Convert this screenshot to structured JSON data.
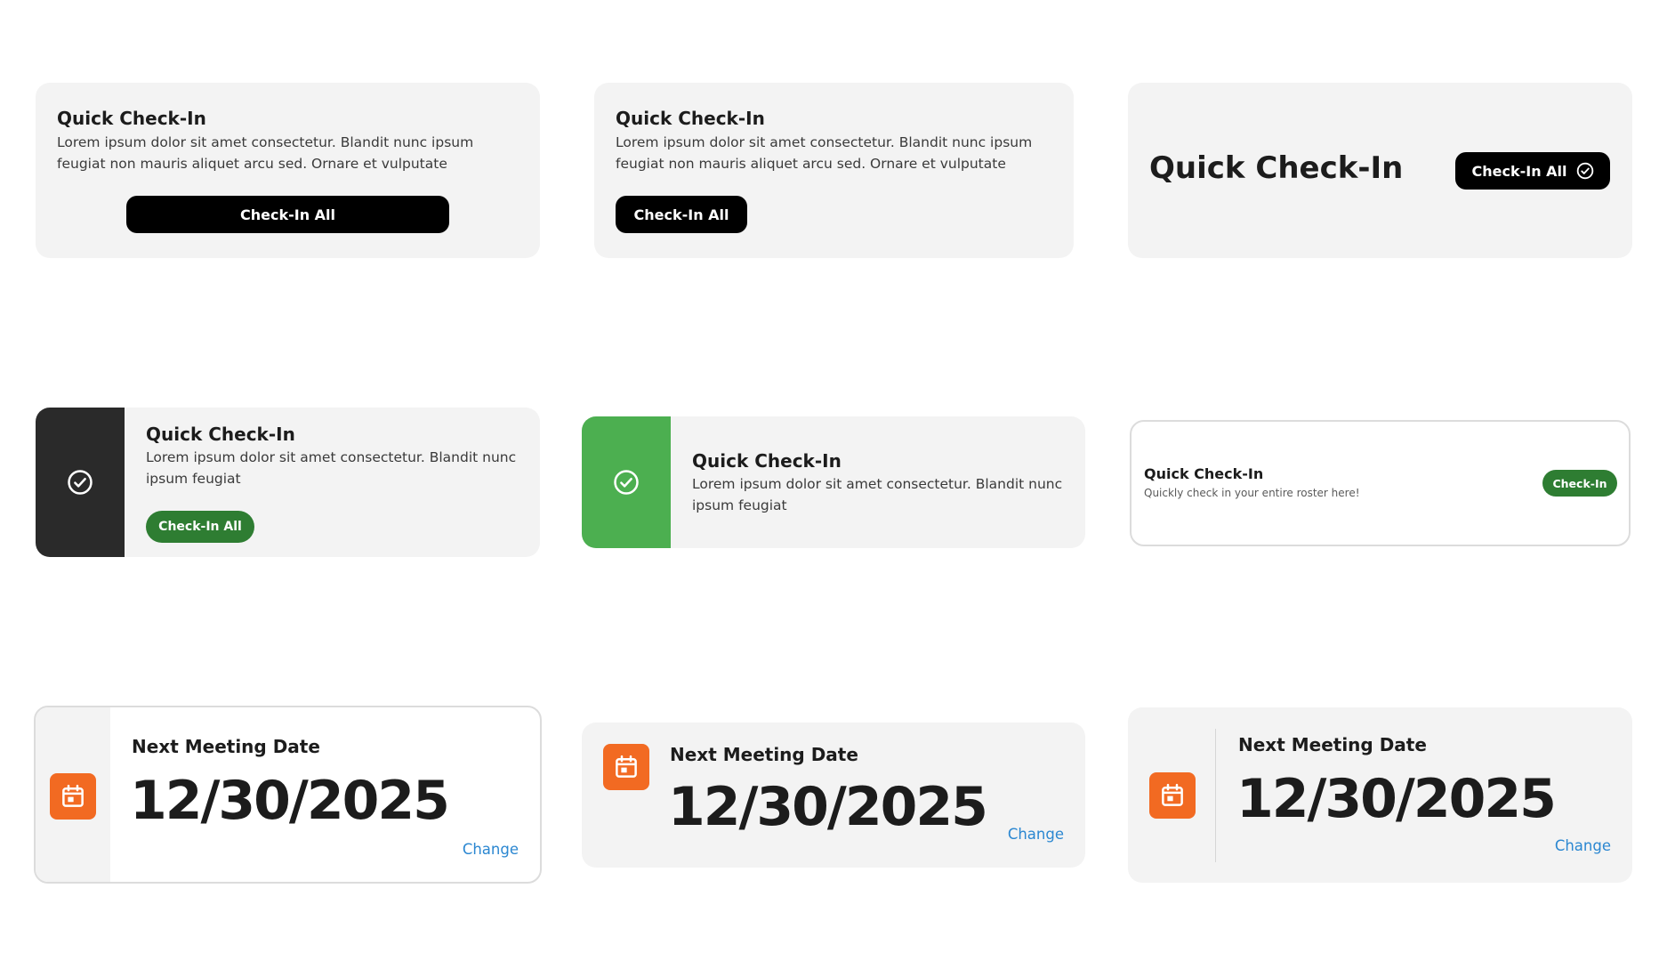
{
  "colors": {
    "card_bg": "#f3f3f3",
    "black": "#000000",
    "dark_panel": "#2a2a2a",
    "green_panel": "#4caf50",
    "green_button": "#2e7d32",
    "calendar_orange": "#f26a22",
    "link_blue": "#2b87d1"
  },
  "checkin_cards": [
    {
      "title": "Quick Check-In",
      "body": "Lorem ipsum dolor sit amet consectetur. Blandit nunc ipsum feugiat non mauris aliquet arcu sed. Ornare et vulputate",
      "button": "Check-In All"
    },
    {
      "title": "Quick Check-In",
      "body": "Lorem ipsum dolor sit amet consectetur. Blandit nunc ipsum feugiat non mauris aliquet arcu sed. Ornare et vulputate",
      "button": "Check-In All"
    },
    {
      "title": "Quick Check-In",
      "button": "Check-In All",
      "button_icon": "check-circle-icon"
    },
    {
      "title": "Quick Check-In",
      "body": "Lorem ipsum dolor sit amet consectetur. Blandit nunc ipsum feugiat",
      "button": "Check-In All",
      "side_icon": "check-circle-icon"
    },
    {
      "title": "Quick Check-In",
      "body": "Lorem ipsum dolor sit amet consectetur. Blandit nunc ipsum feugiat",
      "side_icon": "check-circle-icon"
    },
    {
      "title": "Quick Check-In",
      "subtitle": "Quickly check in your entire roster here!",
      "button": "Check-In"
    }
  ],
  "meeting_cards": [
    {
      "label": "Next Meeting Date",
      "date": "12/30/2025",
      "link": "Change",
      "icon": "calendar-icon"
    },
    {
      "label": "Next Meeting Date",
      "date": "12/30/2025",
      "link": "Change",
      "icon": "calendar-icon"
    },
    {
      "label": "Next Meeting Date",
      "date": "12/30/2025",
      "link": "Change",
      "icon": "calendar-icon"
    }
  ]
}
